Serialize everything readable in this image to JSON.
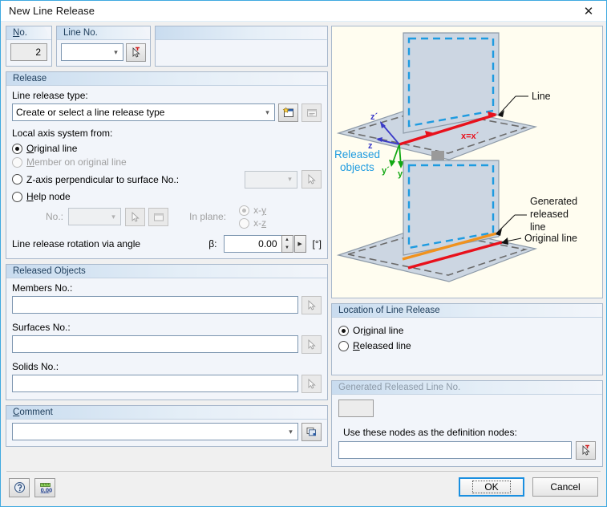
{
  "window": {
    "title": "New Line Release",
    "close_label": "✕"
  },
  "header": {
    "no_label": "No.",
    "no_value": "2",
    "line_no_label": "Line No.",
    "line_no_value": "",
    "line_no_pick_icon": "pick-cursor-icon"
  },
  "release": {
    "group_title": "Release",
    "type_label": "Line release type:",
    "type_value": "Create or select a line release type",
    "new_type_icon": "new-window-icon",
    "edit_type_icon": "edit-window-icon",
    "axis_label": "Local axis system from:",
    "options": [
      {
        "label": "Original line",
        "selected": true,
        "enabled": true
      },
      {
        "label": "Member on original line",
        "selected": false,
        "enabled": false
      },
      {
        "label": "Z-axis perpendicular to surface No.:",
        "selected": false,
        "enabled": true
      },
      {
        "label": "Help node",
        "selected": false,
        "enabled": true
      }
    ],
    "surface_no_value": "",
    "surface_pick_icon": "pick-cursor-icon",
    "help_node_no_label": "No.:",
    "help_node_no_value": "",
    "help_node_pick_icon": "pick-cursor-icon",
    "help_node_new_icon": "new-window-icon",
    "in_plane_label": "In plane:",
    "in_plane_options": [
      {
        "label": "x-y",
        "selected": true
      },
      {
        "label": "x-z",
        "selected": false
      }
    ],
    "rotation_label": "Line release rotation via angle",
    "beta_symbol": "β:",
    "beta_value": "0.00",
    "beta_unit": "[°]"
  },
  "released_objects": {
    "group_title": "Released Objects",
    "fields": [
      {
        "label": "Members No.:",
        "value": "",
        "pick_icon": "pick-cursor-icon"
      },
      {
        "label": "Surfaces No.:",
        "value": "",
        "pick_icon": "pick-cursor-icon"
      },
      {
        "label": "Solids No.:",
        "value": "",
        "pick_icon": "pick-cursor-icon"
      }
    ]
  },
  "comment": {
    "group_title": "Comment",
    "value": "",
    "library_icon": "comment-library-icon"
  },
  "graphic": {
    "labels": {
      "line": "Line",
      "released_objects": "Released\nobjects",
      "x_axis": "x=x´",
      "z_prime": "z´",
      "z": "z",
      "y_prime": "y´",
      "y": "y",
      "generated_released_line": "Generated\nreleased\nline",
      "original_line": "Original line"
    },
    "colors": {
      "released_objects": "#1e9be0",
      "line_red": "#e8111c",
      "generated_orange": "#f0921e",
      "axis_blue": "#3b3bc8",
      "axis_green": "#13a814"
    }
  },
  "location": {
    "group_title": "Location of Line Release",
    "options": [
      {
        "label": "Original line",
        "selected": true
      },
      {
        "label": "Released line",
        "selected": false
      }
    ]
  },
  "generated": {
    "group_title": "Generated Released Line No.",
    "number_value": "",
    "nodes_label": "Use these nodes as the definition nodes:",
    "nodes_value": "",
    "nodes_pick_icon": "pick-cursor-icon"
  },
  "footer": {
    "help_icon": "help-question-icon",
    "units_icon": "units-settings-icon",
    "ok_label": "OK",
    "cancel_label": "Cancel"
  }
}
